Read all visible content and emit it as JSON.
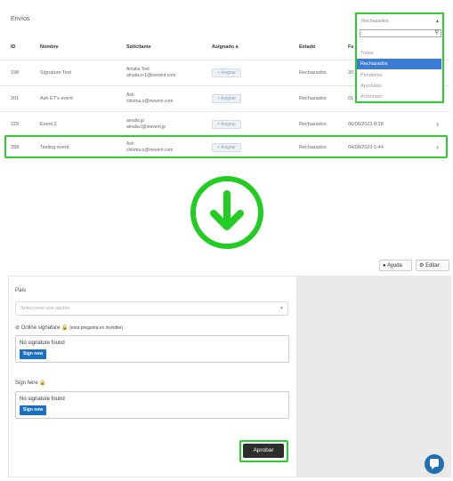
{
  "top": {
    "title": "Envíos",
    "columns": [
      "ID",
      "Nombre",
      "Solicitante",
      "Asignado a",
      "Estado",
      "Fe"
    ],
    "rows": [
      {
        "id": "198",
        "nombre": "Signature Test",
        "sol_name": "Amalia Test",
        "sol_email": "amalia.t+1@inevent.com",
        "assign": "+ Asignar",
        "estado": "Rechazados",
        "fecha": "30"
      },
      {
        "id": "201",
        "nombre": "Ash ET's event",
        "sol_name": "Ash",
        "sol_email": "chioma.o@inevent.com",
        "assign": "+ Asignar",
        "estado": "Rechazados",
        "fecha": "01"
      },
      {
        "id": "229",
        "nombre": "Event 2",
        "sol_name": "amalia jp",
        "sol_email": "amalia.t@inevent.jp",
        "assign": "+ Asignar",
        "estado": "Rechazados",
        "fecha": "06/06/2023 0:28"
      },
      {
        "id": "398",
        "nombre": "Testing event",
        "sol_name": "Ash",
        "sol_email": "chioma.o@inevent.com",
        "assign": "+ Asignar",
        "estado": "Rechazados",
        "fecha": "04/08/2023 5:44"
      }
    ],
    "dropdown": {
      "selected": "Rechazados",
      "options": [
        "Todos",
        "Rechazados",
        "Pendiente",
        "Aprobado",
        "Archivado"
      ]
    }
  },
  "bottom": {
    "help_label": "Ayuda",
    "edit_label": "Editar",
    "pais_label": "País",
    "pais_placeholder": "Seleccione una opción",
    "online_sig_label": "Online signature",
    "online_sig_note": "(esta pregunta es invisible)",
    "no_sig_1": "No signature found",
    "sign_now_1": "Sign now",
    "sign_here_label": "Sign here",
    "no_sig_2": "No signature found",
    "sign_now_2": "Sign now",
    "approve_label": "Aprobar"
  },
  "colors": {
    "highlight": "#2ecc2e",
    "selected_option": "#3b7bd4",
    "sign_button": "#1a6fc2",
    "approve_button": "#2d2d2d",
    "chat_bubble": "#1f6fb4"
  }
}
